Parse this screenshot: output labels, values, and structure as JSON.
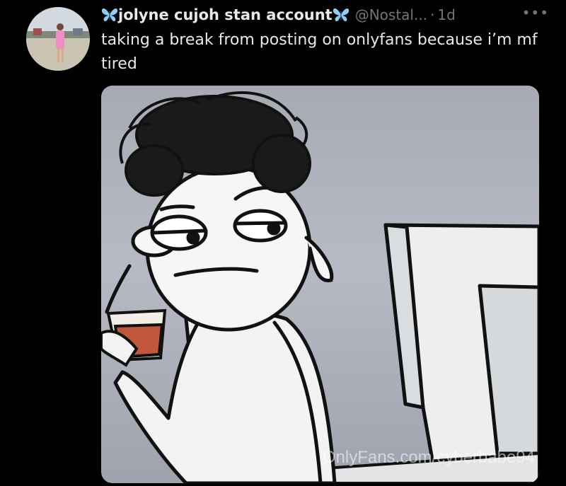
{
  "author": {
    "display_name": "jolyne cujoh stan account",
    "handle": "@Nostal...",
    "separator": "·",
    "time": "1d",
    "name_icons": [
      "butterfly-icon",
      "butterfly-icon"
    ]
  },
  "tweet": {
    "text": "taking a break from posting on onlyfans because i’m mf tired",
    "more_label": "•••"
  },
  "media": {
    "watermark": "OnlyFans.com/cyberbabe94",
    "description_icon": "cartoon-drawing"
  },
  "colors": {
    "background": "#000000",
    "text_primary": "#e7e9ea",
    "text_secondary": "#71767b",
    "butterfly": "#8ecdf5"
  }
}
